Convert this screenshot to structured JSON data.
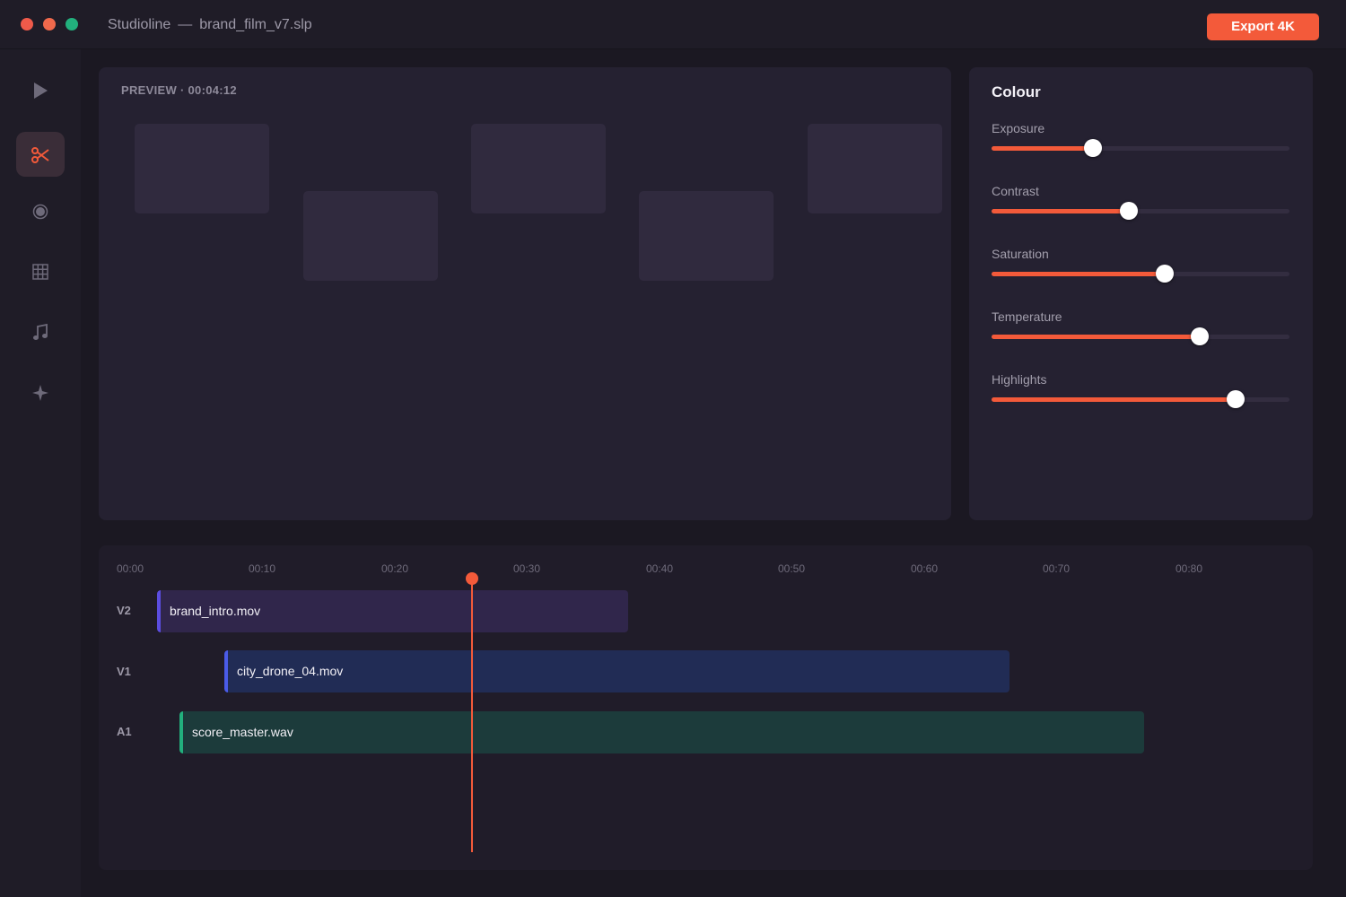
{
  "window": {
    "app_name": "Studioline",
    "separator": "—",
    "file_name": "brand_film_v7.slp"
  },
  "toolbar": {
    "export_label": "Export 4K"
  },
  "sidebar": {
    "items": [
      {
        "icon": "play-icon",
        "active": false
      },
      {
        "icon": "scissors-icon",
        "active": true
      },
      {
        "icon": "record-icon",
        "active": false
      },
      {
        "icon": "grid-icon",
        "active": false
      },
      {
        "icon": "music-note-icon",
        "active": false
      },
      {
        "icon": "sparkle-icon",
        "active": false
      }
    ]
  },
  "preview": {
    "label": "PREVIEW · 00:04:12"
  },
  "colour_panel": {
    "title": "Colour",
    "sliders": [
      {
        "label": "Exposure",
        "value": 0.34
      },
      {
        "label": "Contrast",
        "value": 0.46
      },
      {
        "label": "Saturation",
        "value": 0.58
      },
      {
        "label": "Temperature",
        "value": 0.7
      },
      {
        "label": "Highlights",
        "value": 0.82
      }
    ]
  },
  "timeline": {
    "ticks": [
      "00:00",
      "00:10",
      "00:20",
      "00:30",
      "00:40",
      "00:50",
      "00:60",
      "00:70",
      "00:80"
    ],
    "tracks": [
      {
        "label": "V2",
        "clip": "brand_intro.mov"
      },
      {
        "label": "V1",
        "clip": "city_drone_04.mov"
      },
      {
        "label": "A1",
        "clip": "score_master.wav"
      }
    ]
  },
  "colors": {
    "accent": "#f35a3a",
    "clip_v2": "#30264b",
    "clip_v2_edge": "#5b4de0",
    "clip_v1": "#212c55",
    "clip_v1_edge": "#4a5be8",
    "clip_a1": "#1c3b3b",
    "clip_a1_edge": "#22b07d"
  }
}
